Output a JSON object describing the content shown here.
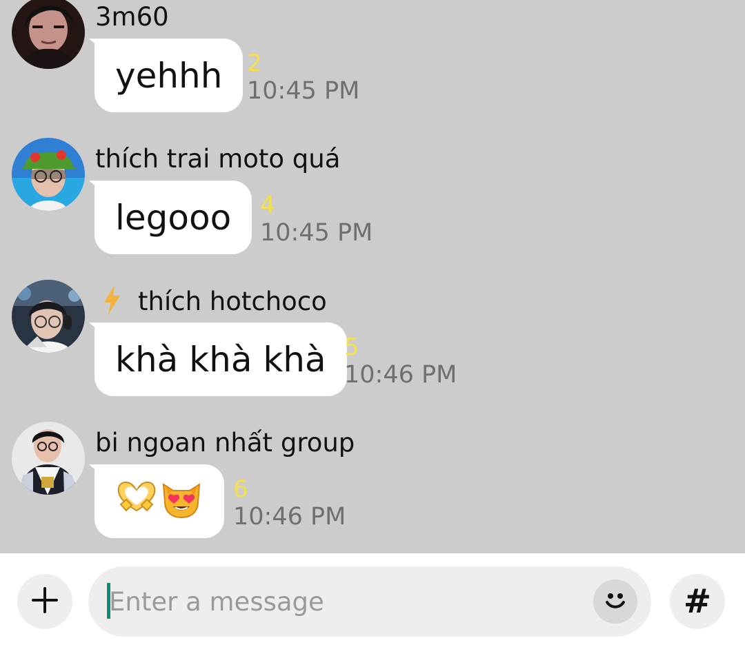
{
  "chat": {
    "messages": [
      {
        "avatar": "avatar-person-icon",
        "sender": "3m60",
        "text": "yehhh",
        "unread_count": "2",
        "time": "10:45 PM"
      },
      {
        "avatar": "avatar-person-green-hat-icon",
        "sender": "thích trai moto quá",
        "text": "legooo",
        "unread_count": "4",
        "time": "10:45 PM"
      },
      {
        "avatar": "avatar-person-headset-icon",
        "sender_icon": "lightning-bolt-icon",
        "sender": "thích hotchoco",
        "text": "khà khà khà",
        "unread_count": "5",
        "time": "10:46 PM"
      },
      {
        "avatar": "avatar-person-jacket-icon",
        "sender": "bi ngoan nhất group",
        "emoji_1": "heart-hands-emoji",
        "emoji_2": "heart-eyes-cat-emoji",
        "unread_count": "6",
        "time": "10:46 PM"
      }
    ]
  },
  "composer": {
    "placeholder": "Enter a message",
    "add_icon": "plus-icon",
    "emoji_icon": "smiley-icon",
    "hashtag_label": "#"
  },
  "colors": {
    "chat_background": "#cccccc",
    "bubble": "#ffffff",
    "unread_count": "#f4e04d",
    "timestamp": "#6f6f6f",
    "cursor": "#0d8b7a"
  }
}
